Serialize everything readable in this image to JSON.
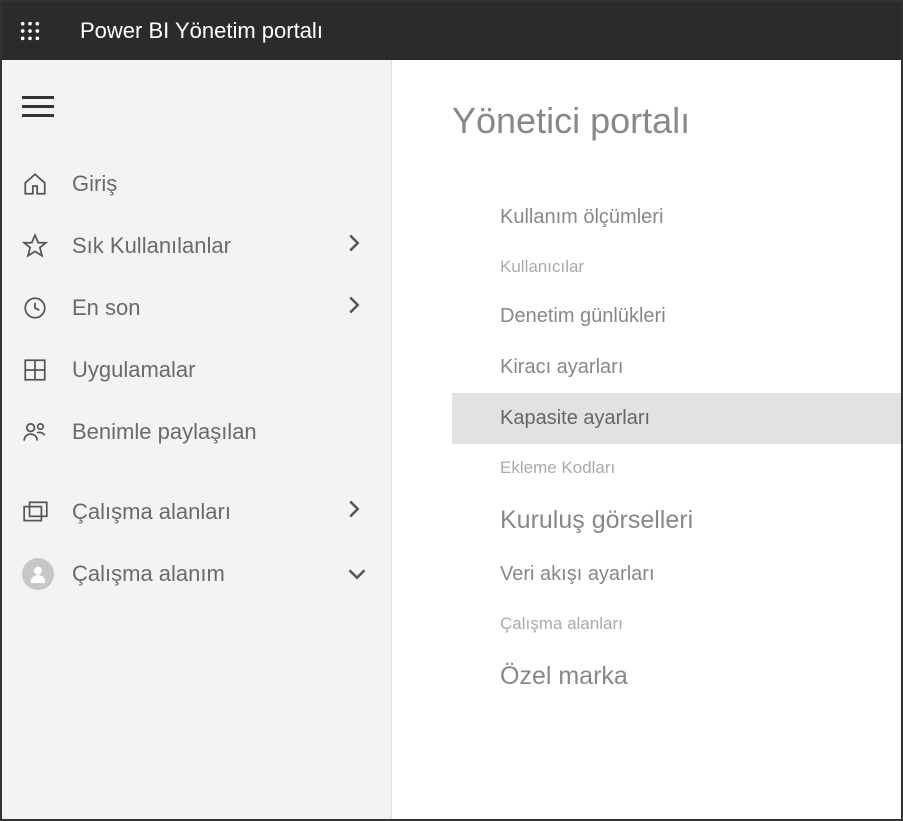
{
  "header": {
    "title": "Power BI Yönetim portalı"
  },
  "sidebar": {
    "items": [
      {
        "icon": "home-icon",
        "label": "Giriş",
        "chevron": false
      },
      {
        "icon": "star-icon",
        "label": "Sık Kullanılanlar",
        "chevron": true
      },
      {
        "icon": "clock-icon",
        "label": "En son",
        "chevron": true
      },
      {
        "icon": "apps-icon",
        "label": "Uygulamalar",
        "chevron": false
      },
      {
        "icon": "shared-icon",
        "label": "Benimle paylaşılan",
        "chevron": false
      },
      {
        "icon": "workspaces-icon",
        "label": "Çalışma alanları",
        "chevron": true
      },
      {
        "icon": "avatar-icon",
        "label": "Çalışma alanım",
        "chevron": "down"
      }
    ]
  },
  "main": {
    "title": "Yönetici portalı",
    "items": [
      {
        "label": "Kullanım ölçümleri",
        "style": "normal"
      },
      {
        "label": "Kullanıcılar",
        "style": "small"
      },
      {
        "label": "Denetim günlükleri",
        "style": "normal"
      },
      {
        "label": "Kiracı ayarları",
        "style": "normal"
      },
      {
        "label": "Kapasite ayarları",
        "style": "normal",
        "selected": true
      },
      {
        "label": "Ekleme Kodları",
        "style": "small"
      },
      {
        "label": "Kuruluş görselleri",
        "style": "big"
      },
      {
        "label": "Veri akışı ayarları",
        "style": "normal"
      },
      {
        "label": "Çalışma alanları",
        "style": "small"
      },
      {
        "label": "Özel marka",
        "style": "big"
      }
    ]
  }
}
